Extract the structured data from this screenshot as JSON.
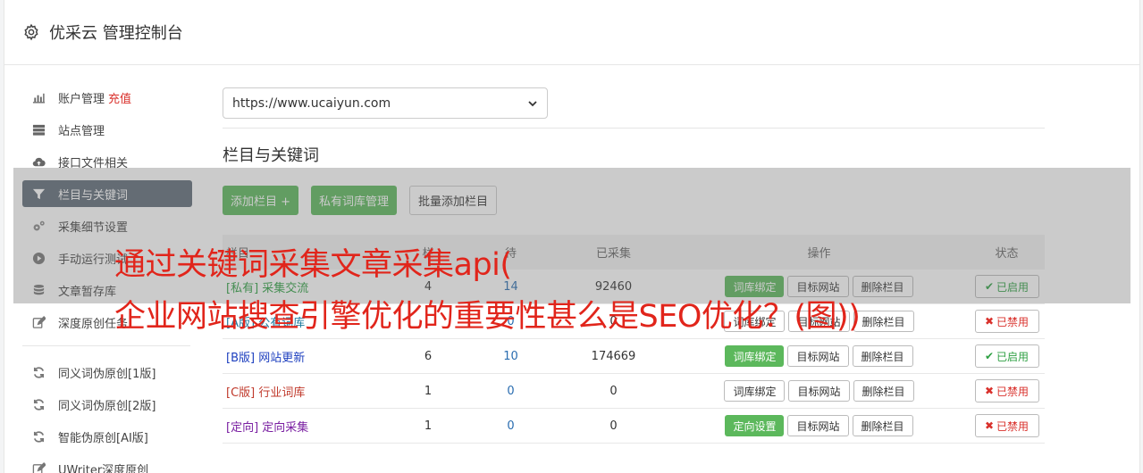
{
  "header": {
    "title": "优采云 管理控制台"
  },
  "sidebar": {
    "items": [
      {
        "label": "账户管理",
        "extra": "充值",
        "icon": "bar-chart-icon"
      },
      {
        "label": "站点管理",
        "icon": "server-icon"
      },
      {
        "label": "接口文件相关",
        "icon": "cloud-upload-icon"
      },
      {
        "label": "栏目与关键词",
        "icon": "filter-icon",
        "active": true
      },
      {
        "label": "采集细节设置",
        "icon": "cogs-icon"
      },
      {
        "label": "手动运行测试",
        "icon": "play-icon"
      },
      {
        "label": "文章暂存库",
        "icon": "database-icon"
      },
      {
        "label": "深度原创任务",
        "icon": "edit-icon"
      }
    ],
    "items2": [
      {
        "label": "同义词伪原创[1版]",
        "icon": "refresh-icon"
      },
      {
        "label": "同义词伪原创[2版]",
        "icon": "refresh-icon"
      },
      {
        "label": "智能伪原创[AI版]",
        "icon": "refresh-icon"
      },
      {
        "label": "UWriter深度原创",
        "icon": "edit-icon"
      }
    ]
  },
  "main": {
    "site_select": "https://www.ucaiyun.com",
    "section_title": "栏目与关键词",
    "buttons": {
      "add_column": "添加栏目 +",
      "private_lib": "私有词库管理",
      "batch_add": "批量添加栏目"
    },
    "table": {
      "headers": {
        "name": "栏目",
        "col_a": "栏",
        "col_b": "待",
        "col_c": "已采集",
        "ops": "操作",
        "status": "状态"
      },
      "rows": [
        {
          "tag": "[私有]",
          "name": "采集交流",
          "a": "4",
          "b": "14",
          "c": "92460",
          "op1": "词库绑定",
          "op1_green": true,
          "op2": "目标网站",
          "op3": "删除栏目",
          "status": "已启用",
          "enabled": true,
          "tagcls": "tag-priv"
        },
        {
          "tag": "[A版]",
          "name": "公有词库",
          "a": "",
          "b": "0",
          "c": "0",
          "op1": "词库绑定",
          "op1_green": false,
          "op2": "目标网站",
          "op3": "删除栏目",
          "status": "已禁用",
          "enabled": false,
          "tagcls": "tag-a"
        },
        {
          "tag": "[B版]",
          "name": "网站更新",
          "a": "6",
          "b": "10",
          "c": "174669",
          "op1": "词库绑定",
          "op1_green": true,
          "op2": "目标网站",
          "op3": "删除栏目",
          "status": "已启用",
          "enabled": true,
          "tagcls": "tag-b"
        },
        {
          "tag": "[C版]",
          "name": "行业词库",
          "a": "1",
          "b": "0",
          "c": "0",
          "op1": "词库绑定",
          "op1_green": false,
          "op2": "目标网站",
          "op3": "删除栏目",
          "status": "已禁用",
          "enabled": false,
          "tagcls": "tag-c"
        },
        {
          "tag": "[定向]",
          "name": "定向采集",
          "a": "1",
          "b": "0",
          "c": "0",
          "op1": "定向设置",
          "op1_green": true,
          "op2": "目标网站",
          "op3": "删除栏目",
          "status": "已禁用",
          "enabled": false,
          "tagcls": "tag-d"
        }
      ]
    }
  },
  "overlay": {
    "line1": "通过关键词采集文章采集api(",
    "line2": "企业网站搜查引擎优化的重要性甚么是SEO优化？(图))"
  },
  "colors": {
    "active_bg": "#5f6b78",
    "green": "#5cb85c",
    "red": "#d9302b"
  }
}
